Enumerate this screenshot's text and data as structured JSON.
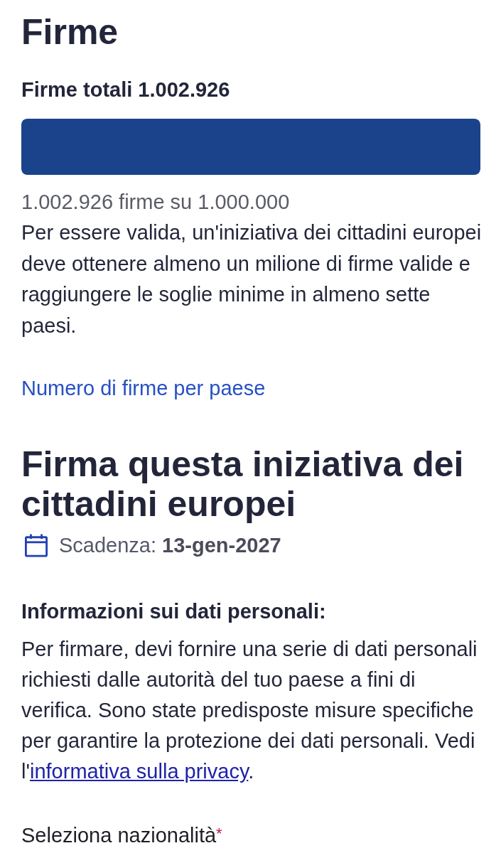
{
  "signatures": {
    "title": "Firme",
    "total_label": "Firme totali 1.002.926",
    "progress": {
      "level": 1
    },
    "progress_text": "1.002.926 firme su 1.000.000",
    "description": "Per essere valida, un'iniziativa dei cittadini europei deve ottenere almeno un milione di firme valide e raggiungere le soglie minime in almeno sette paesi.",
    "country_link": "Numero di firme per paese"
  },
  "sign": {
    "title": "Firma questa iniziativa dei cittadini europei",
    "deadline": "Scadenza: **13-gen-2027**",
    "privacy_heading": "Informazioni sui dati personali:",
    "privacy_text": "Per firmare, devi fornire una serie di dati personali richiesti dalle autorità del tuo paese a fini di verifica. Sono state predisposte misure specifiche per garantire la protezione dei dati personali. Vedi l'",
    "privacy_link": "informativa sulla privacy",
    "privacy_text_end": ".",
    "nationality_label": "Seleziona nazionalità",
    "required_mark": "*"
  }
}
